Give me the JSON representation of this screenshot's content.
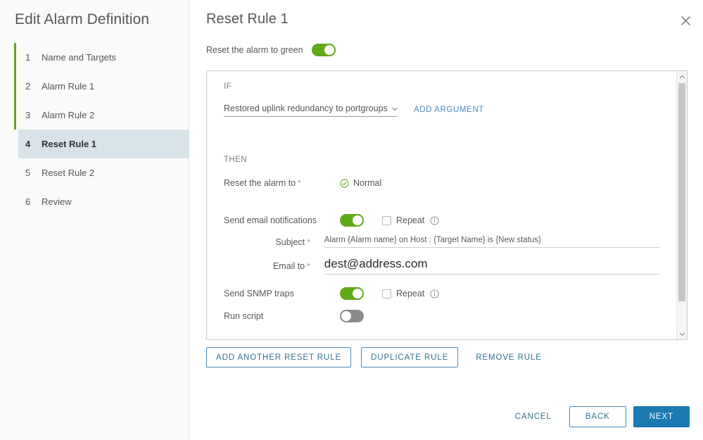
{
  "wizard": {
    "title": "Edit Alarm Definition",
    "steps": [
      {
        "num": "1",
        "label": "Name and Targets"
      },
      {
        "num": "2",
        "label": "Alarm Rule 1"
      },
      {
        "num": "3",
        "label": "Alarm Rule 2"
      },
      {
        "num": "4",
        "label": "Reset Rule 1"
      },
      {
        "num": "5",
        "label": "Reset Rule 2"
      },
      {
        "num": "6",
        "label": "Review"
      }
    ],
    "active_step_index": 3,
    "accent_progress_color": "#62a420",
    "active_step_bg": "#d8e3e9"
  },
  "main": {
    "title": "Reset Rule 1",
    "close_icon": "close-icon",
    "reset_to_green": {
      "label": "Reset the alarm to green",
      "toggle_state": "on",
      "toggle_on_color": "#60a917"
    }
  },
  "rule": {
    "if_label": "IF",
    "then_label": "THEN",
    "trigger": {
      "selected": "Restored uplink redundancy to portgroups",
      "caret_icon": "chevron-down-icon",
      "add_argument_label": "ADD ARGUMENT",
      "link_color": "#4c89b9"
    },
    "reset_alarm_to": {
      "label": "Reset the alarm to",
      "required_marker": "*",
      "status_icon": "circle-check-icon",
      "status_value": "Normal",
      "status_color": "#62a420"
    },
    "email_notifications": {
      "label": "Send email notifications",
      "toggle_state": "on",
      "repeat_label": "Repeat",
      "repeat_checked": false,
      "info_icon": "info-circle-icon"
    },
    "subject": {
      "label": "Subject",
      "required_marker": "*",
      "value": "Alarm {Alarm name} on Host : {Target Name} is {New status}",
      "placeholder": ""
    },
    "email_to": {
      "label": "Email to",
      "required_marker": "*",
      "value": "dest@address.com",
      "placeholder": ""
    },
    "snmp_traps": {
      "label": "Send SNMP traps",
      "toggle_state": "on",
      "repeat_label": "Repeat",
      "repeat_checked": false,
      "info_icon": "info-circle-icon"
    },
    "run_script": {
      "label": "Run script",
      "toggle_state": "off"
    },
    "scrollbar": {
      "up_icon": "chevron-up-icon",
      "down_icon": "chevron-down-icon"
    }
  },
  "rule_actions": {
    "add_another": "ADD ANOTHER RESET RULE",
    "duplicate": "DUPLICATE RULE",
    "remove": "REMOVE RULE"
  },
  "footer": {
    "cancel": "CANCEL",
    "back": "BACK",
    "next": "NEXT",
    "primary_color": "#1b7bb3"
  }
}
